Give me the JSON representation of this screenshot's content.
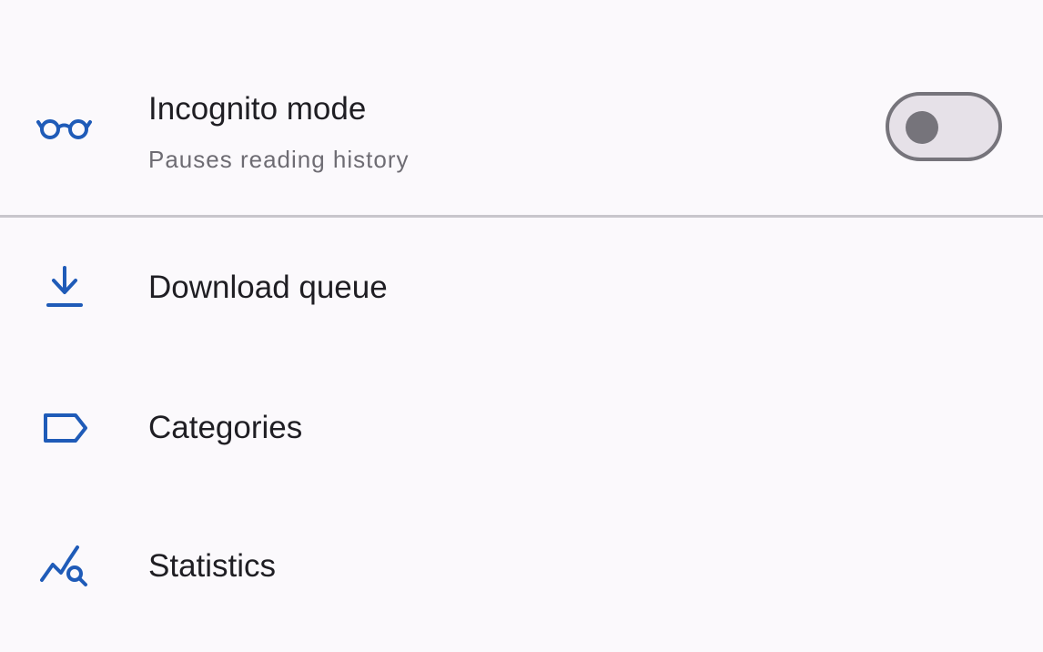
{
  "colors": {
    "accent": "#1f5bb8",
    "background": "#fbf9fc",
    "toggle_off_track": "#e6e1e8",
    "toggle_off_outline": "#76747b",
    "divider": "#c8c6cc"
  },
  "incognito": {
    "icon": "glasses-icon",
    "title": "Incognito mode",
    "subtitle": "Pauses reading history",
    "toggle_state": "off"
  },
  "menu": [
    {
      "icon": "download-icon",
      "label": "Download queue"
    },
    {
      "icon": "label-tag-icon",
      "label": "Categories"
    },
    {
      "icon": "statistics-icon",
      "label": "Statistics"
    }
  ]
}
